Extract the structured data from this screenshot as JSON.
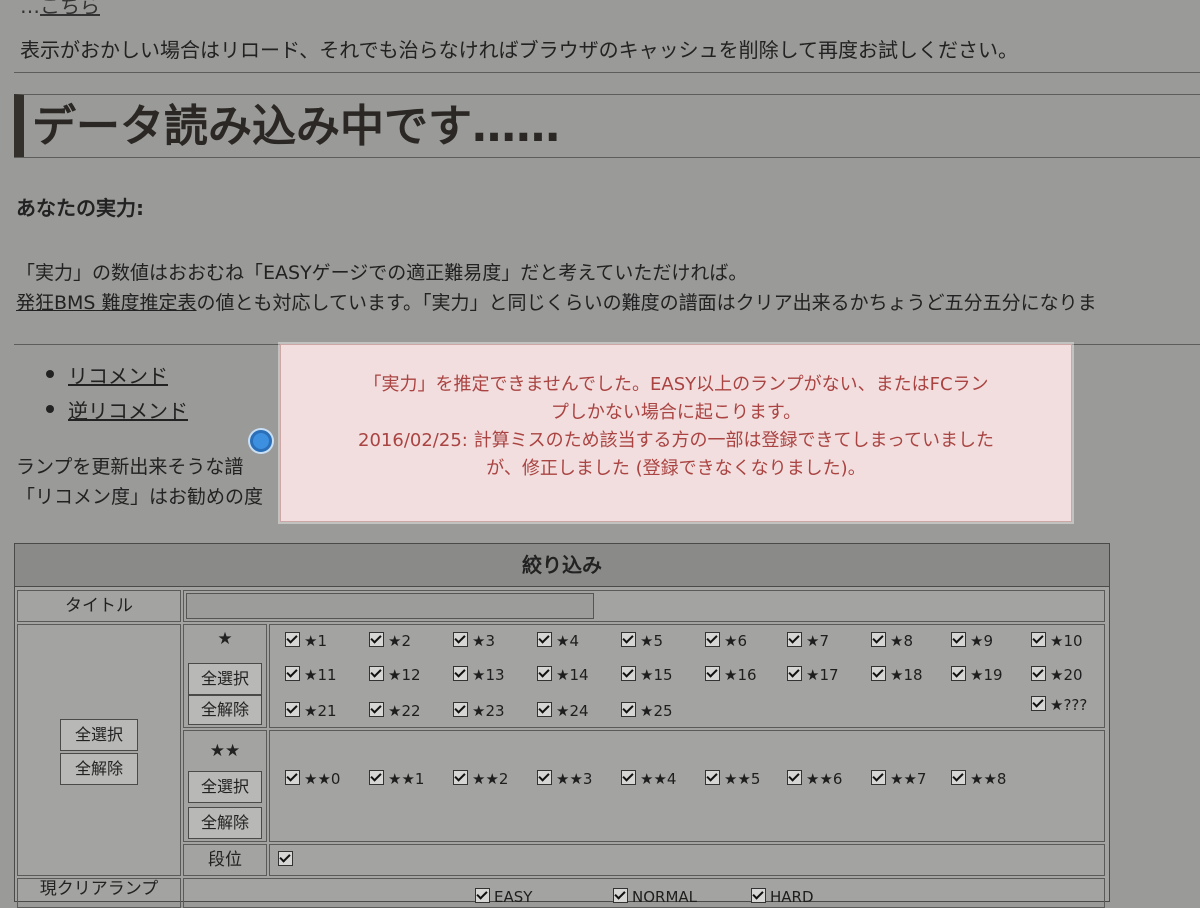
{
  "top_cutoff_text": "こちら",
  "notice": "表示がおかしい場合はリロード、それでも治らなければブラウザのキャッシュを削除して再度お試しください。",
  "heading": "データ読み込み中です……",
  "ability_label": "あなたの実力:",
  "para1": "「実力」の数値はおおむね「EASYゲージでの適正難易度」だと考えていただければ。",
  "para2_link": "発狂BMS 難度推定表",
  "para2_rest": "の値とも対応しています。「実力」と同じくらいの難度の譜面はクリア出来るかちょうど五分五分になりま",
  "links": [
    "リコメンド",
    "逆リコメンド"
  ],
  "para3": "ランプを更新出来そうな譜",
  "para4": "「リコメン度」はお勧めの度",
  "popup": {
    "line1": "「実力」を推定できませんでした。EASY以上のランプがない、またはFCラン",
    "line2": "プしかない場合に起こります。",
    "line3": "2016/02/25: 計算ミスのため該当する方の一部は登録できてしまっていました",
    "line4": "が、修正しました (登録できなくなりました)。"
  },
  "filter": {
    "title": "絞り込み",
    "title_label": "タイトル",
    "select_all": "全選択",
    "deselect_all": "全解除",
    "star1_label": "★",
    "star2_label": "★★",
    "dan_label": "段位",
    "clear_lamp_label": "現クリアランプ",
    "star1_items": [
      "★1",
      "★2",
      "★3",
      "★4",
      "★5",
      "★6",
      "★7",
      "★8",
      "★9",
      "★10",
      "★11",
      "★12",
      "★13",
      "★14",
      "★15",
      "★16",
      "★17",
      "★18",
      "★19",
      "★20",
      "★21",
      "★22",
      "★23",
      "★24",
      "★25",
      "★???"
    ],
    "star2_items": [
      "★★0",
      "★★1",
      "★★2",
      "★★3",
      "★★4",
      "★★5",
      "★★6",
      "★★7",
      "★★8"
    ],
    "lamp_items": [
      "EASY",
      "NORMAL",
      "HARD"
    ]
  }
}
